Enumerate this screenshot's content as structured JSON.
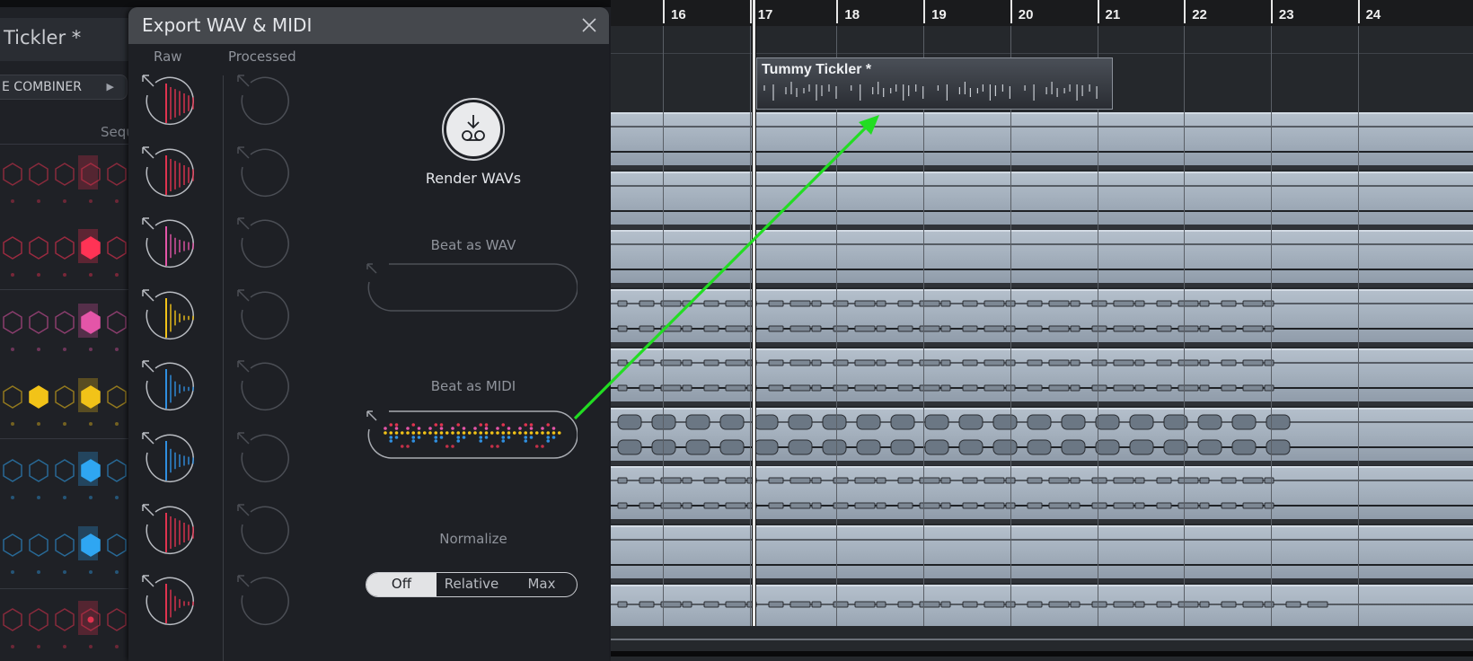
{
  "plugin": {
    "title": "Tickler *",
    "combiner_label": "E COMBINER",
    "combiner_arrow_icon": "triangle-right-icon",
    "sequencer_label": "Sequ",
    "rows": [
      {
        "color": "#e0334f",
        "filled": [
          false,
          false,
          false,
          false,
          false
        ],
        "highlight": 3,
        "dot_center": false
      },
      {
        "color": "#ff3355",
        "filled": [
          false,
          false,
          false,
          true,
          false
        ],
        "highlight": 3,
        "dot_center": false
      },
      {
        "color": "#e455a8",
        "filled": [
          false,
          false,
          false,
          true,
          false
        ],
        "highlight": 3,
        "dot_center": false
      },
      {
        "color": "#f2c318",
        "filled": [
          false,
          true,
          false,
          true,
          false
        ],
        "highlight": 3,
        "dot_center": false
      },
      {
        "color": "#2fa6f2",
        "filled": [
          false,
          false,
          false,
          true,
          false
        ],
        "highlight": 3,
        "dot_center": false
      },
      {
        "color": "#2fa6f2",
        "filled": [
          false,
          false,
          false,
          true,
          false
        ],
        "highlight": 3,
        "dot_center": false
      },
      {
        "color": "#e0334f",
        "filled": [
          false,
          false,
          false,
          false,
          false
        ],
        "highlight": 3,
        "dot_center": true
      }
    ]
  },
  "dialog": {
    "title": "Export WAV & MIDI",
    "close_icon": "close-icon",
    "col_raw": "Raw",
    "col_processed": "Processed",
    "stems": [
      {
        "color": "#e0334f",
        "decay": "slow"
      },
      {
        "color": "#e0334f",
        "decay": "slow"
      },
      {
        "color": "#e455a8",
        "decay": "medium"
      },
      {
        "color": "#f2c318",
        "decay": "fast"
      },
      {
        "color": "#2f8fe0",
        "decay": "fast"
      },
      {
        "color": "#2f8fe0",
        "decay": "medium"
      },
      {
        "color": "#e0334f",
        "decay": "slow"
      },
      {
        "color": "#e0334f",
        "decay": "fast"
      }
    ],
    "render_label": "Render WAVs",
    "render_icon": "download-tape-icon",
    "beat_wav_label": "Beat as WAV",
    "beat_midi_label": "Beat as MIDI",
    "normalize_label": "Normalize",
    "normalize_options": [
      "Off",
      "Relative",
      "Max"
    ],
    "normalize_selected": "Off"
  },
  "daw": {
    "bars": [
      "16",
      "17",
      "18",
      "19",
      "20",
      "21",
      "22",
      "23",
      "24"
    ],
    "midi_part_name": "Tummy Tickler *",
    "tracks": [
      {
        "waveform": "empty"
      },
      {
        "waveform": "empty"
      },
      {
        "waveform": "empty"
      },
      {
        "waveform": "thin-hits"
      },
      {
        "waveform": "thin-hits"
      },
      {
        "waveform": "big-hits"
      },
      {
        "waveform": "thin-hits"
      },
      {
        "waveform": "empty"
      },
      {
        "waveform": "single-line-hits"
      }
    ],
    "annotation": "drag-arrow",
    "annotation_color": "#22dd22"
  }
}
